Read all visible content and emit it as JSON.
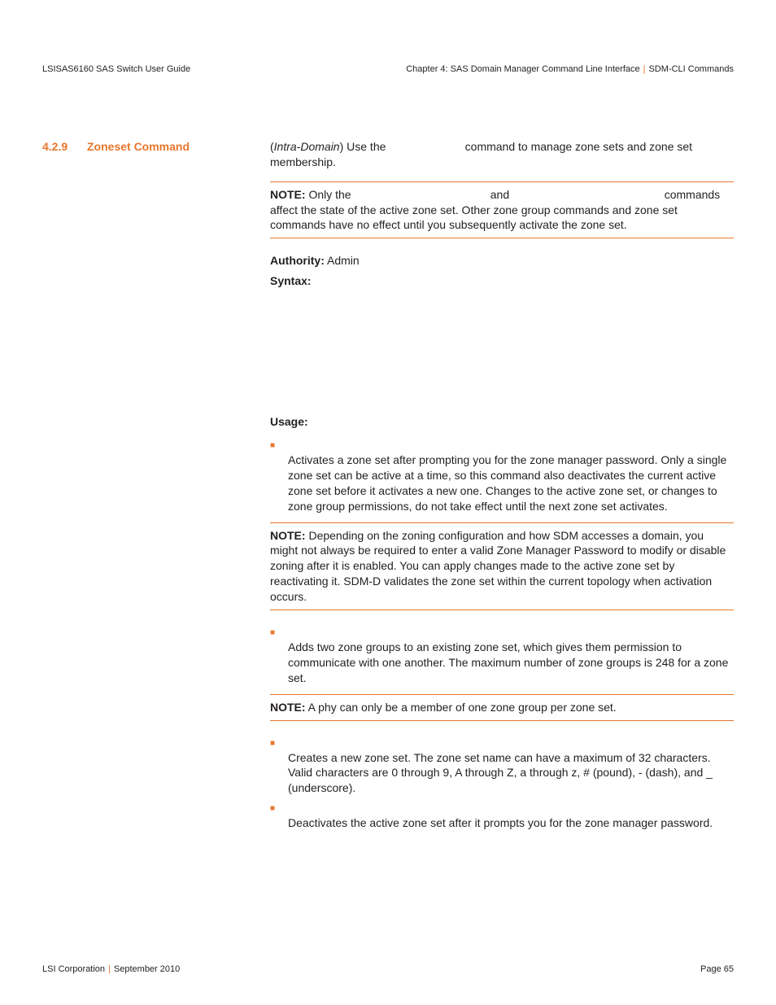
{
  "header": {
    "left": "LSISAS6160 SAS Switch User Guide",
    "right_chapter": "Chapter 4: SAS Domain Manager Command Line Interface",
    "right_section": "SDM-CLI Commands"
  },
  "section": {
    "number": "4.2.9",
    "title": "Zoneset Command"
  },
  "intro": {
    "prefix": "Intra-Domain",
    "line1_a": ") Use the ",
    "line1_b": " command to manage zone sets and zone set membership."
  },
  "note1": {
    "label": "NOTE:",
    "seg1": "  Only the ",
    "seg2": " and ",
    "seg3": " commands affect the state of the active zone set. Other zone group commands and zone set commands have no effect until you subsequently activate the zone set."
  },
  "authority": {
    "label": "Authority:",
    "value": " Admin"
  },
  "syntax_label": "Syntax:",
  "usage_label": "Usage:",
  "bullet1": {
    "desc": "Activates a zone set after prompting you for the zone manager password. Only a single zone set can be active at a time, so this command also deactivates the current active zone set before it activates a new one. Changes to the active zone set, or changes to zone group permissions, do not take effect until the next zone set activates."
  },
  "note2": {
    "label": "NOTE:",
    "text": "  Depending on the zoning configuration and how SDM accesses a domain, you might not always be required to enter a valid Zone Manager Password to modify or disable zoning after it is enabled. You can apply changes made to the active zone set by reactivating it. SDM-D validates the zone set within the current topology when activation occurs."
  },
  "bullet2": {
    "desc": "Adds two zone groups to an existing zone set, which gives them permission to communicate with one another. The maximum number of zone groups is 248 for a zone set."
  },
  "note3": {
    "label": "NOTE:",
    "text": "  A phy can only be a member of one zone group per zone set."
  },
  "bullet3": {
    "desc": "Creates a new zone set. The zone set name can have a maximum of 32 characters. Valid characters are 0 through 9, A through Z, a through z, # (pound), - (dash), and _ (underscore)."
  },
  "bullet4": {
    "desc": "Deactivates the active zone set after it prompts you for the zone manager password."
  },
  "footer": {
    "left_company": "LSI Corporation",
    "left_date": "September 2010",
    "right": "Page 65"
  }
}
